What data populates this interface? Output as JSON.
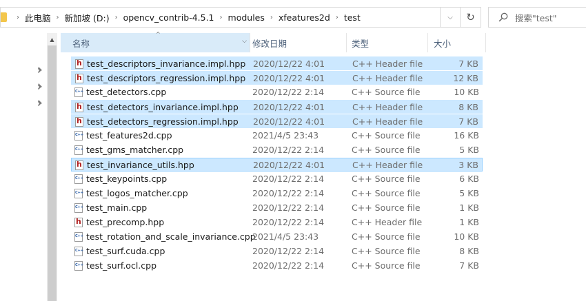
{
  "address": {
    "breadcrumbs": [
      "此电脑",
      "新加坡 (D:)",
      "opencv_contrib-4.5.1",
      "modules",
      "xfeatures2d",
      "test"
    ]
  },
  "search": {
    "placeholder": "搜索\"test\""
  },
  "columns": {
    "name": "名称",
    "date": "修改日期",
    "type": "类型",
    "size": "大小"
  },
  "files": [
    {
      "name": "test_descriptors_invariance.impl.hpp",
      "date": "2020/12/22 4:01",
      "type": "C++ Header file",
      "size": "7 KB",
      "icon": "header-file-icon",
      "selected": true
    },
    {
      "name": "test_descriptors_regression.impl.hpp",
      "date": "2020/12/22 4:01",
      "type": "C++ Header file",
      "size": "12 KB",
      "icon": "header-file-icon",
      "selected": true
    },
    {
      "name": "test_detectors.cpp",
      "date": "2020/12/22 2:14",
      "type": "C++ Source file",
      "size": "10 KB",
      "icon": "cpp-file-icon",
      "selected": false
    },
    {
      "name": "test_detectors_invariance.impl.hpp",
      "date": "2020/12/22 4:01",
      "type": "C++ Header file",
      "size": "8 KB",
      "icon": "header-file-icon",
      "selected": true
    },
    {
      "name": "test_detectors_regression.impl.hpp",
      "date": "2020/12/22 4:01",
      "type": "C++ Header file",
      "size": "7 KB",
      "icon": "header-file-icon",
      "selected": true
    },
    {
      "name": "test_features2d.cpp",
      "date": "2021/4/5 23:43",
      "type": "C++ Source file",
      "size": "16 KB",
      "icon": "cpp-file-icon",
      "selected": false
    },
    {
      "name": "test_gms_matcher.cpp",
      "date": "2020/12/22 2:14",
      "type": "C++ Source file",
      "size": "5 KB",
      "icon": "cpp-file-icon",
      "selected": false
    },
    {
      "name": "test_invariance_utils.hpp",
      "date": "2020/12/22 4:01",
      "type": "C++ Header file",
      "size": "3 KB",
      "icon": "header-file-icon",
      "selected": true,
      "focused": true
    },
    {
      "name": "test_keypoints.cpp",
      "date": "2020/12/22 2:14",
      "type": "C++ Source file",
      "size": "6 KB",
      "icon": "cpp-file-icon",
      "selected": false
    },
    {
      "name": "test_logos_matcher.cpp",
      "date": "2020/12/22 2:14",
      "type": "C++ Source file",
      "size": "5 KB",
      "icon": "cpp-file-icon",
      "selected": false
    },
    {
      "name": "test_main.cpp",
      "date": "2020/12/22 2:14",
      "type": "C++ Source file",
      "size": "1 KB",
      "icon": "cpp-file-icon",
      "selected": false
    },
    {
      "name": "test_precomp.hpp",
      "date": "2020/12/22 2:14",
      "type": "C++ Header file",
      "size": "1 KB",
      "icon": "header-file-icon",
      "selected": false
    },
    {
      "name": "test_rotation_and_scale_invariance.cpp",
      "date": "2021/4/5 23:43",
      "type": "C++ Source file",
      "size": "10 KB",
      "icon": "cpp-file-icon",
      "selected": false
    },
    {
      "name": "test_surf.cuda.cpp",
      "date": "2020/12/22 2:14",
      "type": "C++ Source file",
      "size": "8 KB",
      "icon": "cpp-file-icon",
      "selected": false
    },
    {
      "name": "test_surf.ocl.cpp",
      "date": "2020/12/22 2:14",
      "type": "C++ Source file",
      "size": "7 KB",
      "icon": "cpp-file-icon",
      "selected": false
    }
  ],
  "colors": {
    "selection": "#cce8ff",
    "header_hover": "#d9ebf9",
    "header_text": "#4c607a",
    "meta_text": "#6d6d6d"
  }
}
